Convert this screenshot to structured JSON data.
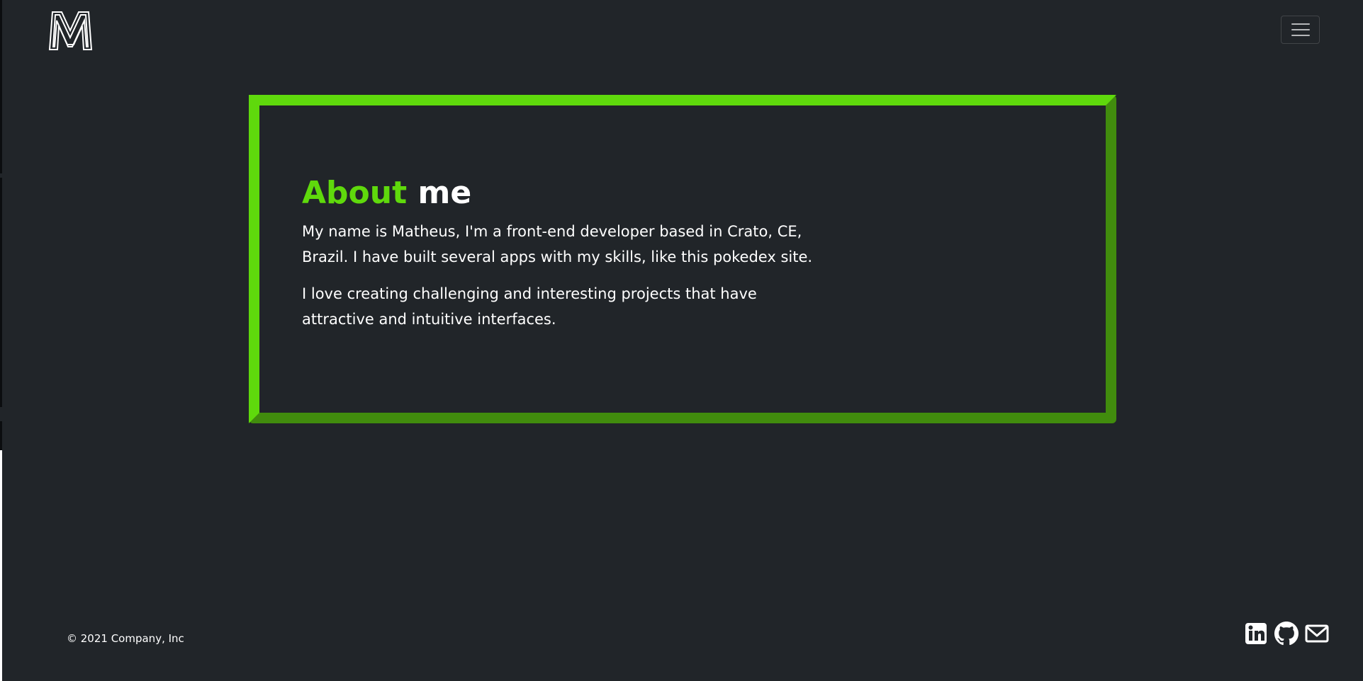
{
  "header": {
    "logo_icon": "m-logo-icon",
    "menu_icon": "hamburger-menu-icon"
  },
  "about": {
    "title_accent": "About",
    "title_rest": "me",
    "paragraphs": [
      "My name is Matheus, I'm a front-end developer based in Crato, CE, Brazil. I have built several apps with my skills, like this pokedex site.",
      "I love creating challenging and interesting projects that have attractive and intuitive interfaces."
    ]
  },
  "footer": {
    "copyright": "© 2021 Company, Inc",
    "social_icons": [
      "linkedin-icon",
      "github-icon",
      "email-icon"
    ]
  },
  "colors": {
    "background": "#212529",
    "accent": "#5fd90c",
    "accent_dark": "#418c0d",
    "text": "#ffffff"
  }
}
